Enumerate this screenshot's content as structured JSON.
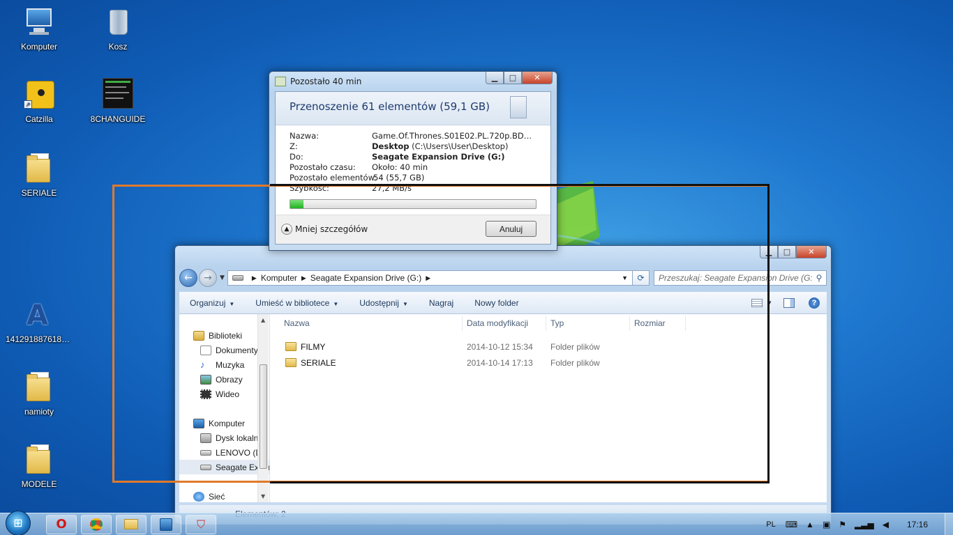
{
  "desktop": {
    "icons": [
      {
        "label": "Komputer",
        "icon": "computer-icon"
      },
      {
        "label": "Kosz",
        "icon": "recycle-bin-icon"
      },
      {
        "label": "Catzilla",
        "icon": "catzilla-shortcut-icon"
      },
      {
        "label": "8CHANGUIDE",
        "icon": "image-file-icon"
      },
      {
        "label": "SERIALE",
        "icon": "folder-icon"
      },
      {
        "label": "1412918876188418...",
        "icon": "alcohol-app-icon"
      },
      {
        "label": "namioty",
        "icon": "folder-icon"
      },
      {
        "label": "MODELE",
        "icon": "folder-icon"
      }
    ]
  },
  "copy_dialog": {
    "title": "Pozostało 40 min",
    "header": "Przenoszenie 61 elementów (59,1 GB)",
    "rows": {
      "name_key": "Nazwa:",
      "name_val": "Game.Of.Thrones.S01E02.PL.720p.BDRip.Xv...",
      "from_key": "Z:",
      "from_bold": "Desktop",
      "from_rest": " (C:\\Users\\User\\Desktop)",
      "to_key": "Do:",
      "to_val": "Seagate Expansion Drive (G:)",
      "time_key": "Pozostało czasu:",
      "time_val": "Około: 40 min",
      "items_key": "Pozostało elementów:",
      "items_val": "54 (55,7 GB)",
      "speed_key": "Szybkość:",
      "speed_val": "27,2 MB/s"
    },
    "progress_fraction": 0.055,
    "less_details": "Mniej szczegółów",
    "cancel": "Anuluj"
  },
  "explorer": {
    "breadcrumb": [
      "Komputer",
      "Seagate Expansion Drive (G:)"
    ],
    "search_placeholder": "Przeszukaj: Seagate Expansion Drive (G:)",
    "commands": {
      "organize": "Organizuj",
      "include_library": "Umieść w bibliotece",
      "share": "Udostępnij",
      "burn": "Nagraj",
      "new_folder": "Nowy folder"
    },
    "nav": {
      "libraries": "Biblioteki",
      "documents": "Dokumenty",
      "music": "Muzyka",
      "pictures": "Obrazy",
      "videos": "Wideo",
      "computer": "Komputer",
      "local_disk": "Dysk lokalny",
      "lenovo": "LENOVO (D:)",
      "seagate": "Seagate Expansion Drive (G:)",
      "network": "Sieć"
    },
    "columns": {
      "name": "Nazwa",
      "date": "Data modyfikacji",
      "type": "Typ",
      "size": "Rozmiar"
    },
    "files": [
      {
        "name": "FILMY",
        "date": "2014-10-12 15:34",
        "type": "Folder plików"
      },
      {
        "name": "SERIALE",
        "date": "2014-10-14 17:13",
        "type": "Folder plików"
      }
    ],
    "status": "Elementów: 2"
  },
  "taskbar": {
    "language": "PL",
    "clock": "17:16"
  }
}
